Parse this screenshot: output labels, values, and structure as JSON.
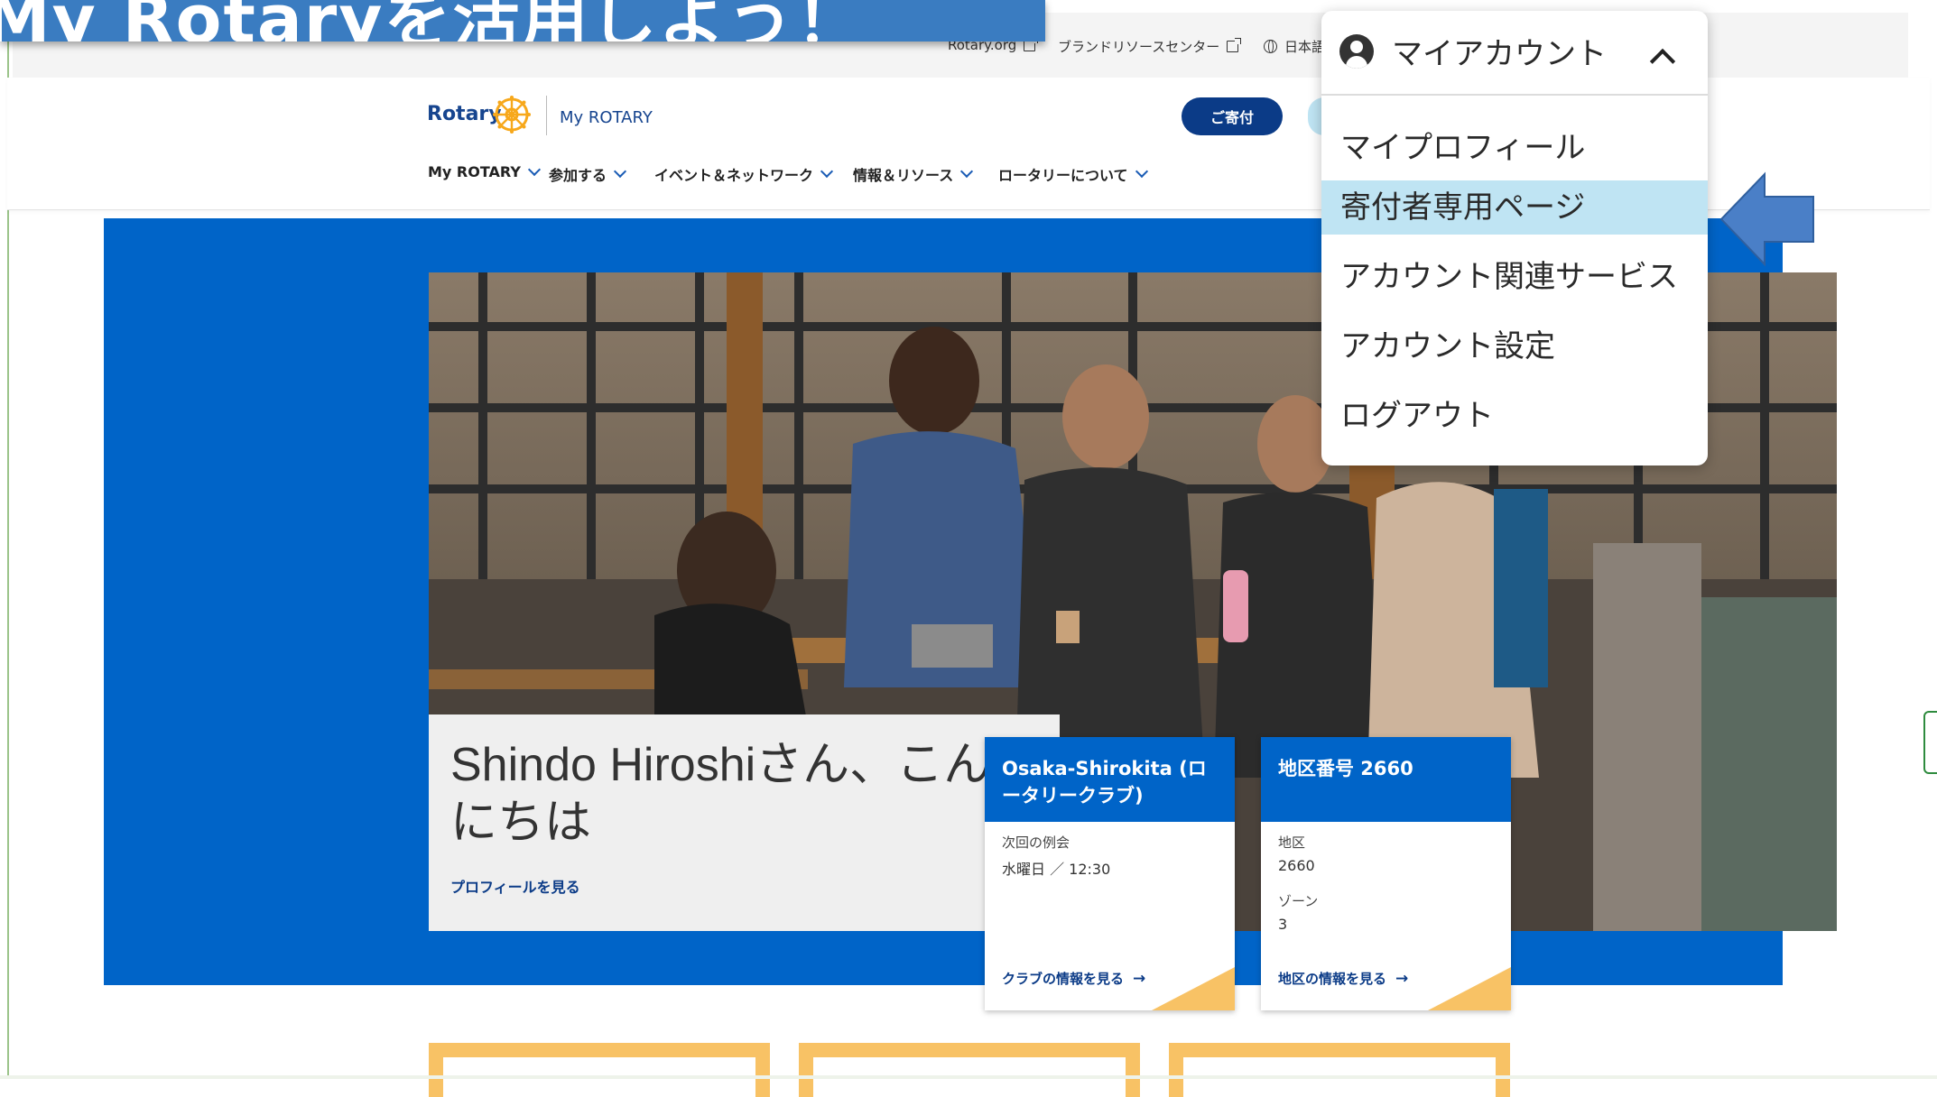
{
  "slide": {
    "title_fragment": "My Rotaryを活用しよう！"
  },
  "utility": {
    "rotary_org": "Rotary.org",
    "brand_center": "ブランドリソースセンター",
    "language": "日本語"
  },
  "header": {
    "logo_text": "Rotary",
    "logo_sub": "My ROTARY",
    "donate_label": "ご寄付"
  },
  "nav": {
    "items": [
      {
        "label": "My ROTARY"
      },
      {
        "label": "参加する"
      },
      {
        "label": "イベント＆ネットワーク"
      },
      {
        "label": "情報＆リソース"
      },
      {
        "label": "ロータリーについて"
      }
    ]
  },
  "hero": {
    "greeting": "Shindo Hiroshiさん、こんにちは",
    "profile_link": "プロフィールを見る"
  },
  "club_card": {
    "title": "Osaka-Shirokita (ロータリークラブ)",
    "meeting_label": "次回の例会",
    "meeting_value": "水曜日 ／ 12:30",
    "link": "クラブの情報を見る"
  },
  "district_card": {
    "title": "地区番号 2660",
    "district_label": "地区",
    "district_value": "2660",
    "zone_label": "ゾーン",
    "zone_value": "3",
    "link": "地区の情報を見る"
  },
  "dropdown": {
    "title": "マイアカウント",
    "items": [
      {
        "label": "マイプロフィール"
      },
      {
        "label": "寄付者専用ページ"
      },
      {
        "label": "アカウント関連サービス"
      },
      {
        "label": "アカウント設定"
      },
      {
        "label": "ログアウト"
      }
    ],
    "highlighted_index": 1
  },
  "colors": {
    "rotary_blue": "#0064c8",
    "navy": "#0b3b87",
    "gold": "#f8c265",
    "highlight": "#bfe4f3",
    "callout": "#4a7fc7"
  }
}
